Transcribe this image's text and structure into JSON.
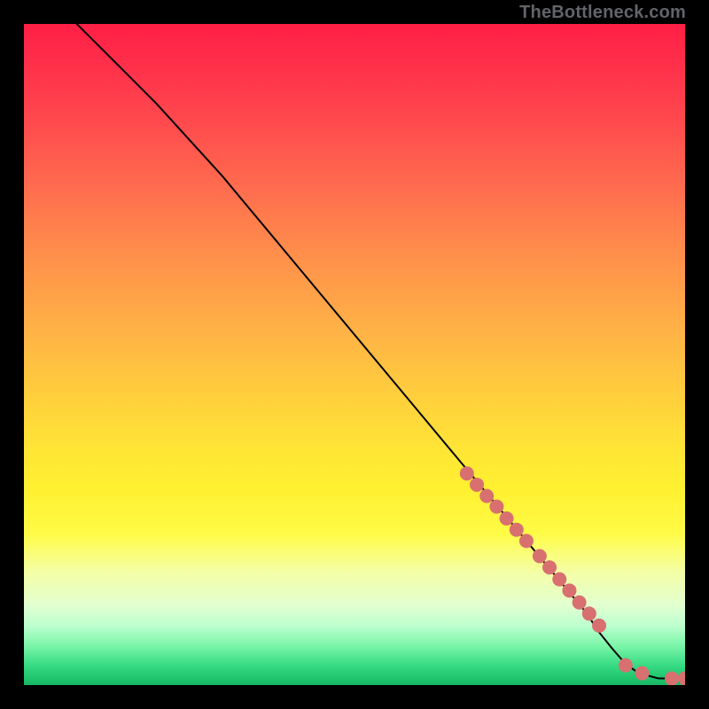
{
  "attribution": "TheBottleneck.com",
  "chart_data": {
    "type": "line",
    "title": "",
    "xlabel": "",
    "ylabel": "",
    "xlim": [
      0,
      100
    ],
    "ylim": [
      0,
      100
    ],
    "grid": false,
    "legend": false,
    "series": [
      {
        "name": "curve",
        "type": "line",
        "color": "#000000",
        "x": [
          8,
          10,
          12,
          15,
          20,
          25,
          30,
          35,
          40,
          45,
          50,
          55,
          60,
          65,
          70,
          75,
          80,
          85,
          87,
          89,
          91,
          93,
          96,
          100
        ],
        "y": [
          100,
          98,
          96,
          93,
          88,
          82.5,
          77,
          71,
          65,
          59,
          53,
          47,
          41,
          35,
          29,
          23,
          17,
          11,
          8,
          5.5,
          3.2,
          1.8,
          1.0,
          1.0
        ]
      },
      {
        "name": "highlight-dots",
        "type": "scatter",
        "color": "#d87070",
        "x": [
          67,
          68.5,
          70,
          71.5,
          73,
          74.5,
          76,
          78,
          79.5,
          81,
          82.5,
          84,
          85.5,
          87,
          91,
          93.5,
          98,
          100
        ],
        "y": [
          32,
          30.3,
          28.6,
          27,
          25.2,
          23.5,
          21.8,
          19.5,
          17.8,
          16,
          14.3,
          12.5,
          10.8,
          9.0,
          3.0,
          1.8,
          1.0,
          1.0
        ]
      }
    ]
  }
}
